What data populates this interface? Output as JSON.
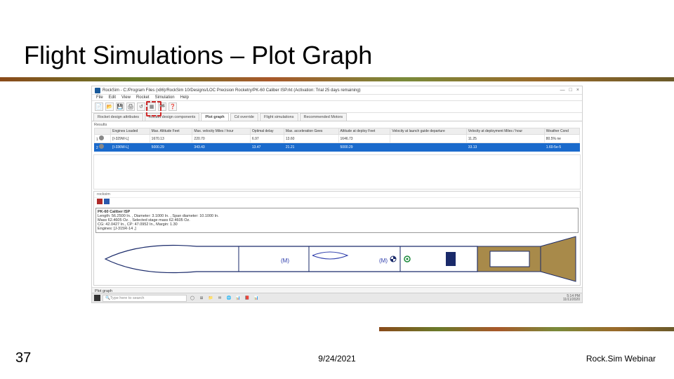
{
  "slide": {
    "title": "Flight Simulations – Plot Graph",
    "page_number": "37",
    "date": "9/24/2021",
    "footer_title": "Rock.Sim Webinar"
  },
  "app": {
    "window_title": "RockSim - C:/Program Files (x86)/RockSim 10/Designs/LOC Precision Rocketry/PK-60 Caliber ISP.rkt  (Activation: Trial 25 days remaining)",
    "win_min": "—",
    "win_max": "□",
    "win_close": "×",
    "menu": [
      "File",
      "Edit",
      "View",
      "Rocket",
      "Simulation",
      "Help"
    ],
    "toolbar_icons": [
      "📄",
      "📂",
      "💾",
      "🖨",
      "↺",
      "▦",
      "🏁",
      "❓"
    ],
    "tabs": [
      "Rocket design attributes",
      "Rocket design components",
      "Plot graph",
      "Cd override",
      "Flight simulations",
      "Recommended Motors"
    ],
    "active_tab": "Plot graph",
    "results_label": "Results",
    "sim_headers": [
      "",
      "Engines Loaded",
      "Max. Altitude\nFeet",
      "Max. velocity\nMiles / hour",
      "Optimal delay",
      "Max. acceleration\nGees",
      "Altitude at deploy\nFeet",
      "Velocity at launch guide departure",
      "Velocity at deployment\nMiles / hour",
      "Weather Cond"
    ],
    "sim_rows": [
      {
        "sel": false,
        "cells": [
          "[I-329W-L]",
          "1670.13",
          "220.70",
          "6.97",
          "13.60",
          "1646.73",
          "",
          "11.25",
          "80.5% ne"
        ]
      },
      {
        "sel": true,
        "cells": [
          "[I-336W-L]",
          "5000.29",
          "343.43",
          "13.47",
          "21.21",
          "5000.29",
          "",
          "33.13",
          "1.60-5e-5"
        ]
      }
    ],
    "rocket_tabs_label": "rocksim",
    "rocket_info": {
      "title": "PK-60 Caliber ISP",
      "line1": "Length: 56.2500 In. , Diameter: 3.1000 In. , Span diameter: 10.1000 In.",
      "line2": "Mass 62.4605 Oz. , Selected stage mass 62.4605 Oz.",
      "line3": "CG: 42.0427 In., CP: 47.0952 In., Margin: 1.30",
      "line4": "Engines: [J-315R-14 ,]"
    },
    "rocket_labels": {
      "m1": "(M)",
      "m2": "(M)"
    },
    "plot_graph_label": "Plot graph"
  },
  "taskbar": {
    "search_placeholder": "Type here to search",
    "tb_icons": [
      "⊞",
      "◯",
      "📁",
      "✉",
      "🌐",
      "📊",
      "📕",
      "📊",
      "🟦",
      "🟥"
    ],
    "clock_time": "5:14 PM",
    "clock_date": "11/11/2020"
  }
}
